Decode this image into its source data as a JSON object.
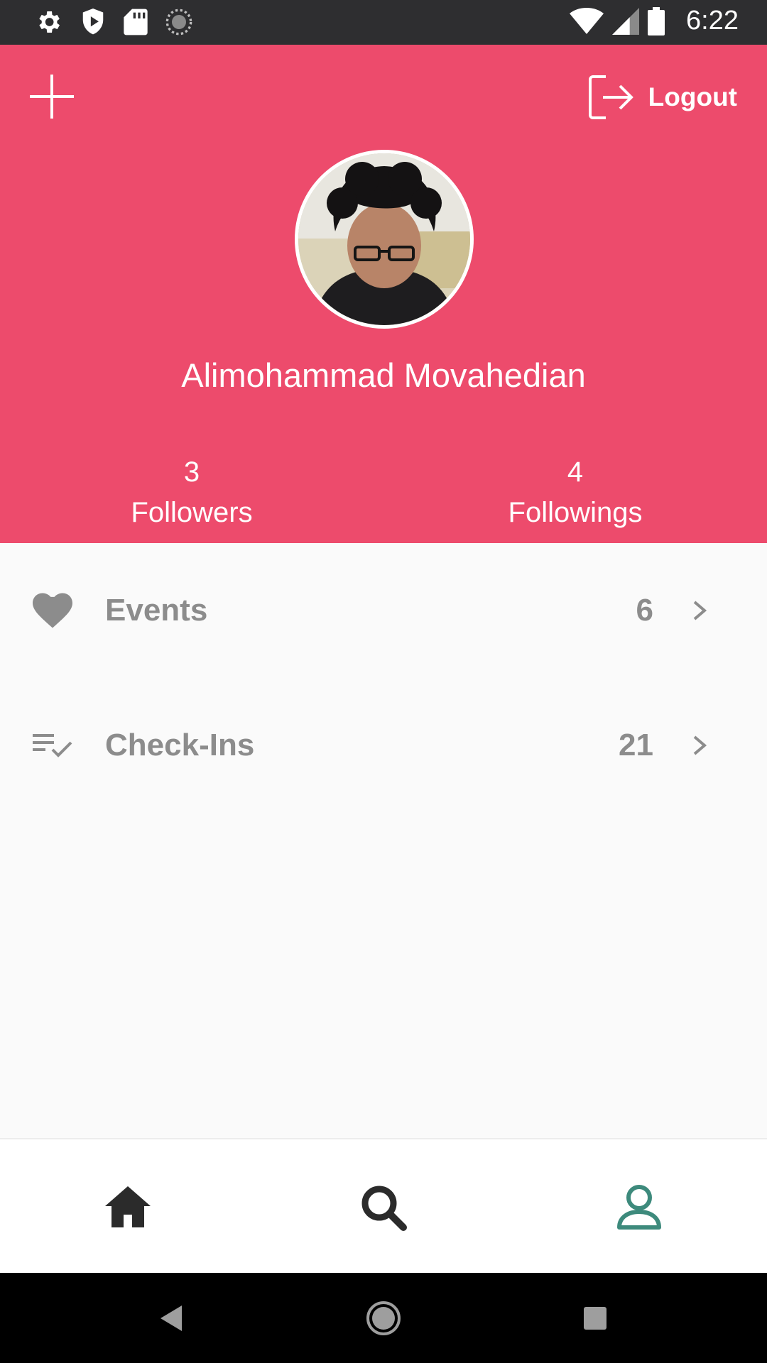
{
  "status_bar": {
    "time": "6:22",
    "icons": [
      "gear-icon",
      "shield-play-icon",
      "sd-card-icon",
      "sync-icon",
      "wifi-icon",
      "signal-icon",
      "battery-icon"
    ]
  },
  "header": {
    "logout_label": "Logout",
    "user_name": "Alimohammad Movahedian",
    "followers": {
      "count": "3",
      "label": "Followers"
    },
    "followings": {
      "count": "4",
      "label": "Followings"
    },
    "background_color": "#ed4b6c"
  },
  "menu": {
    "items": [
      {
        "label": "Events",
        "count": "6",
        "icon": "heart-icon"
      },
      {
        "label": "Check-Ins",
        "count": "21",
        "icon": "list-check-icon"
      }
    ]
  },
  "bottom_nav": {
    "items": [
      "home-icon",
      "search-icon",
      "profile-icon"
    ],
    "active": "profile-icon",
    "active_color": "#3d8a7c"
  },
  "system_nav": [
    "back-icon",
    "home-circle-icon",
    "recents-icon"
  ]
}
